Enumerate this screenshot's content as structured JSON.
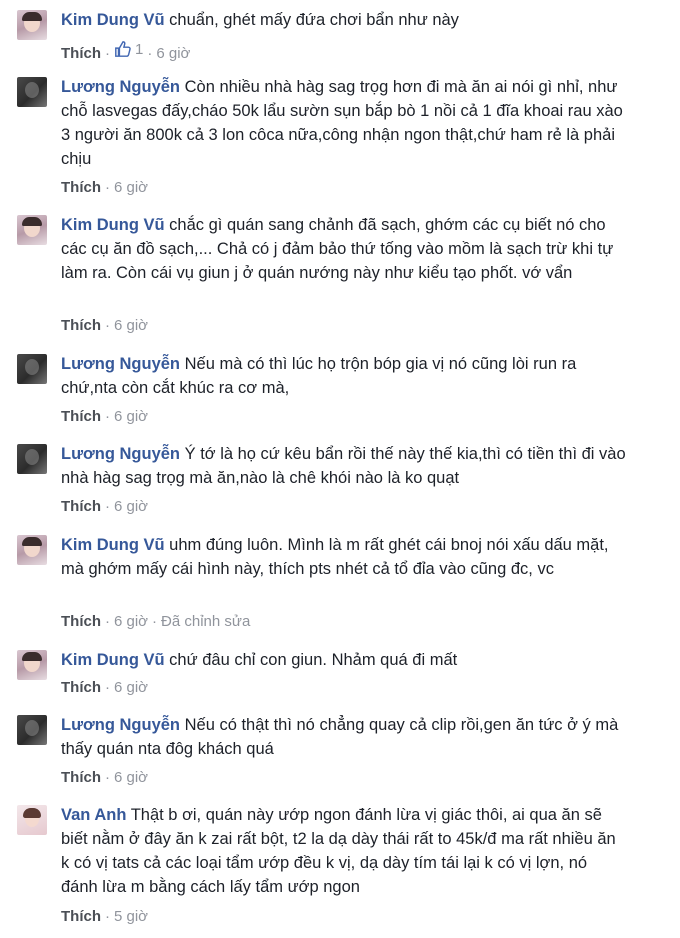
{
  "comments": [
    {
      "author": "Kim Dung Vũ",
      "text": "chuẩn, ghét mấy đứa chơi bẩn như này",
      "like_label": "Thích",
      "likes": "1",
      "time": "6 giờ",
      "avatar": "woman-selfie-avatar"
    },
    {
      "author": "Lương Nguyễn",
      "text": "Còn nhiều nhà hàg sag trọg hơn đi mà ăn ai nói gì nhỉ, như chỗ lasvegas đấy,cháo 50k lẩu sườn sụn bắp bò 1 nồi cả 1 đĩa khoai rau xào 3 người ăn 800k cả 3 lon côca nữa,công nhận ngon thật,chứ ham rẻ là phải chịu",
      "like_label": "Thích",
      "time": "6 giờ",
      "avatar": "dark-portrait-avatar"
    },
    {
      "author": "Kim Dung Vũ",
      "text": "chắc gì quán sang chảnh đã sạch, ghớm các cụ biết nó cho các cụ ăn đồ sạch,... Chả có j đảm bảo thứ tống vào mồm là sạch trừ khi tự làm ra. Còn cái vụ giun j ở quán nướng này như kiểu tạo phốt. vớ vẩn",
      "like_label": "Thích",
      "time": "6 giờ",
      "avatar": "woman-selfie-avatar"
    },
    {
      "author": "Lương Nguyễn",
      "text": "Nếu mà có thì lúc họ trộn bóp gia vị nó cũng lòi run ra chứ,nta còn cắt khúc ra cơ mà,",
      "like_label": "Thích",
      "time": "6 giờ",
      "avatar": "dark-portrait-avatar"
    },
    {
      "author": "Lương Nguyễn",
      "text": "Ý tớ là họ cứ kêu bẩn rồi thế này thế kia,thì có tiền thì đi vào nhà hàg sag trọg mà ăn,nào là chê khói nào là ko quạt",
      "like_label": "Thích",
      "time": "6 giờ",
      "avatar": "dark-portrait-avatar"
    },
    {
      "author": "Kim Dung Vũ",
      "text": "uhm đúng luôn. Mình là m rất ghét cái bnoj nói xấu dấu mặt, mà ghớm mấy cái hình này, thích pts nhét cả tổ đỉa vào cũng đc, vc",
      "like_label": "Thích",
      "time": "6 giờ",
      "edited": "Đã chỉnh sửa",
      "avatar": "woman-selfie-avatar"
    },
    {
      "author": "Kim Dung Vũ",
      "text": "chứ đâu chỉ con giun. Nhảm quá đi mất",
      "like_label": "Thích",
      "time": "6 giờ",
      "avatar": "woman-selfie-avatar"
    },
    {
      "author": "Lương Nguyễn",
      "text": "Nếu có thật thì nó chẳng quay cả clip rồi,gen ăn tức ở ý mà thấy quán nta đôg khách quá",
      "like_label": "Thích",
      "time": "6 giờ",
      "avatar": "dark-portrait-avatar"
    },
    {
      "author": "Van Anh",
      "text": "Thật b ơi, quán này ướp ngon đánh lừa vị giác thôi, ai qua ăn sẽ biết nằm ở đây ăn k zai rất bột, t2 la dạ dày thái rất to 45k/đ ma rất nhiều ăn k có vị tats cả các loại tẩm ướp đều k vị, dạ dày tím tái lại k có vị lợn, nó đánh lừa m bằng cách lấy tẩm ướp ngon",
      "like_label": "Thích",
      "time": "5 giờ",
      "avatar": "woman-portrait-avatar"
    }
  ],
  "colors": {
    "author": "#365899",
    "meta": "#90949c",
    "text": "#1d2129"
  }
}
